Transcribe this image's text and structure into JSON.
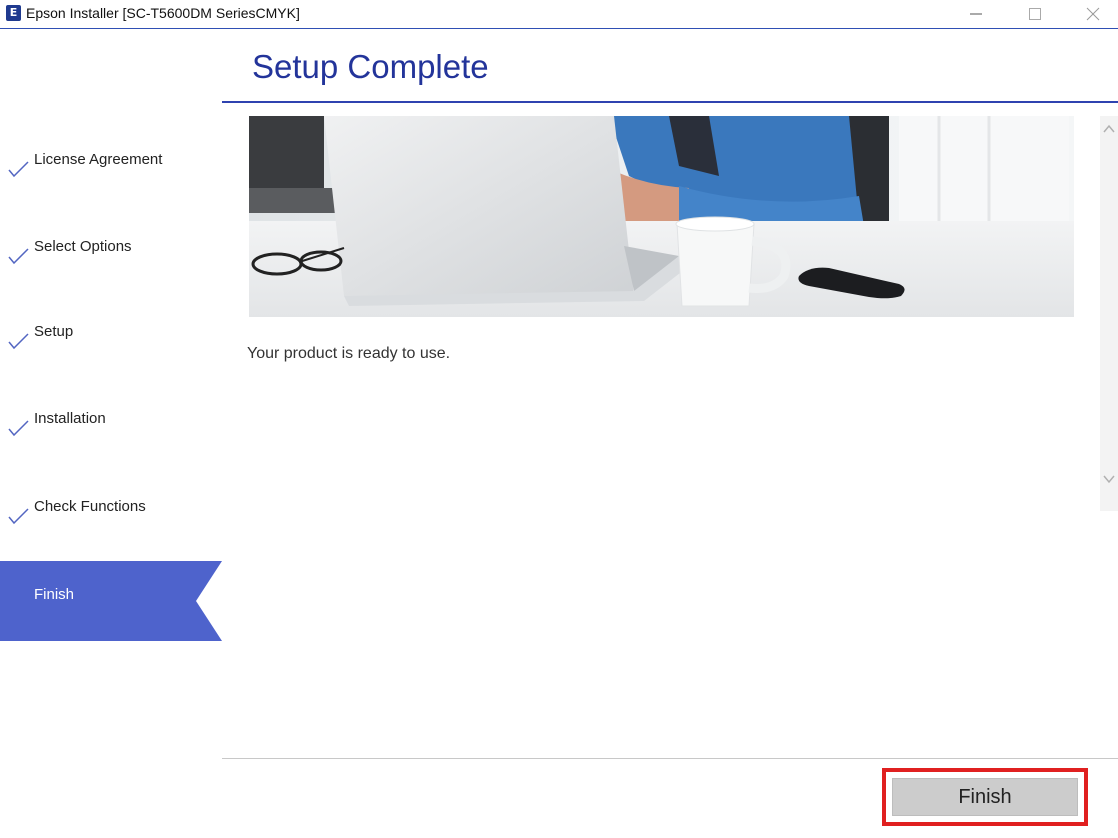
{
  "window": {
    "title": "Epson Installer [SC-T5600DM SeriesCMYK]",
    "icon_letter": "E",
    "icon": "epson-app-icon",
    "controls": [
      "minimize-icon",
      "maximize-icon",
      "close-icon"
    ]
  },
  "sidebar": {
    "steps": [
      {
        "label": "License Agreement",
        "done": true,
        "icon": "check-icon"
      },
      {
        "label": "Select Options",
        "done": true,
        "icon": "check-icon"
      },
      {
        "label": "Setup",
        "done": true,
        "icon": "check-icon"
      },
      {
        "label": "Installation",
        "done": true,
        "icon": "check-icon"
      },
      {
        "label": "Check Functions",
        "done": true,
        "icon": "check-icon"
      }
    ],
    "active_step": {
      "label": "Finish"
    }
  },
  "main": {
    "title": "Setup Complete",
    "message": "Your product is ready to use.",
    "hero_image": "office-desk-laptop-photo"
  },
  "footer": {
    "finish_label": "Finish"
  },
  "colors": {
    "accent": "#4e63cc",
    "title": "#23349a",
    "highlight_border": "#e02020",
    "button_bg": "#cccccc"
  }
}
